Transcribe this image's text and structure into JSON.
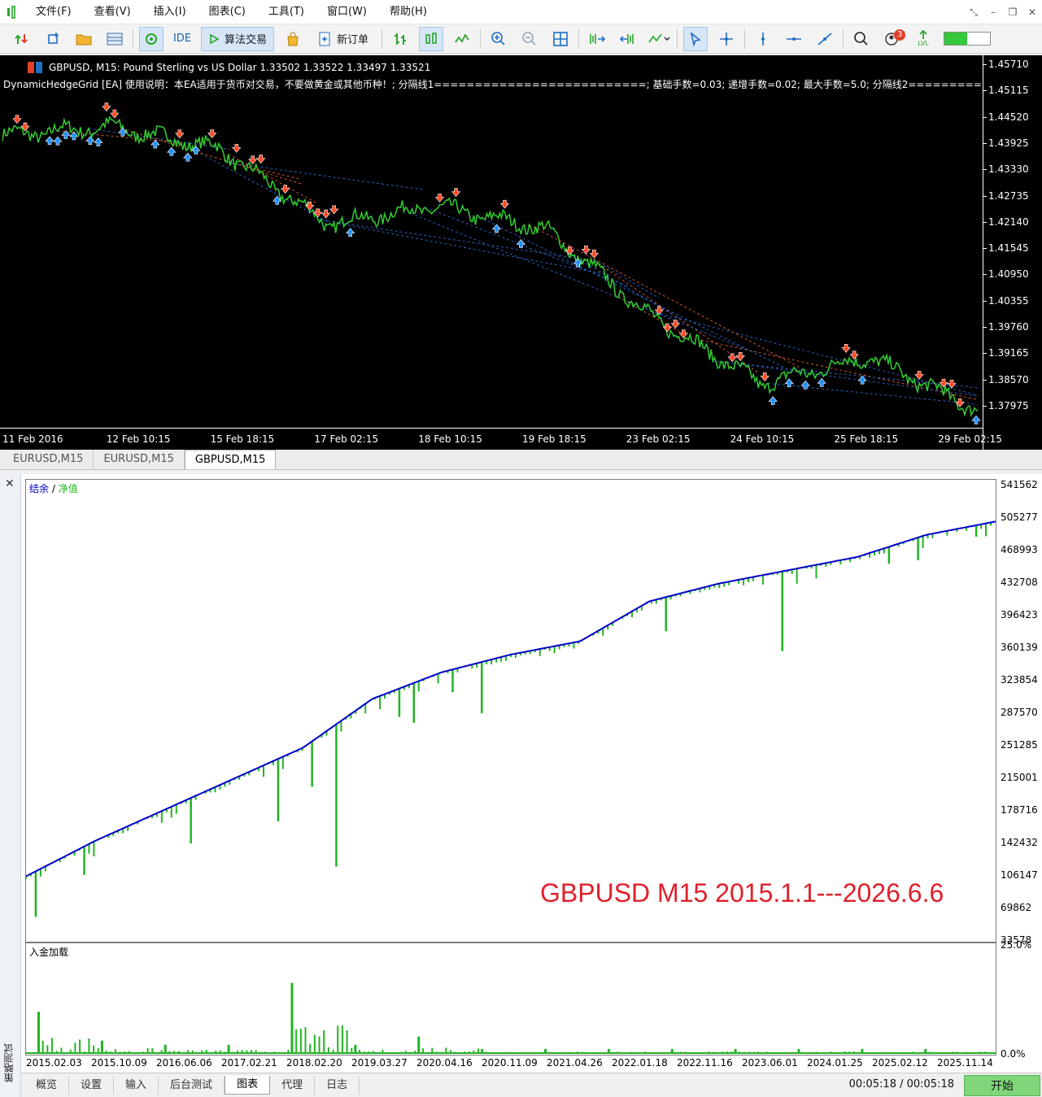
{
  "menu": {
    "items": [
      "文件(F)",
      "查看(V)",
      "插入(I)",
      "图表(C)",
      "工具(T)",
      "窗口(W)",
      "帮助(H)"
    ]
  },
  "toolbar": {
    "ide_label": "IDE",
    "algo_label": "算法交易",
    "new_order_label": "新订单",
    "notification_count": "3",
    "lvl_label": "LVL",
    "lvl_level": 0.5,
    "icons": [
      "new-chart-icon",
      "add-icon",
      "folder-icon",
      "profiles-icon",
      "algo-settings-icon",
      "play-icon",
      "shopping-bag-icon",
      "new-order-icon",
      "bar-chart-icon",
      "candlestick-icon",
      "line-chart-icon",
      "zoom-in-icon",
      "zoom-out-icon",
      "grid-icon",
      "shift-chart-icon",
      "autoscroll-icon",
      "indicators-icon",
      "cursor-icon",
      "crosshair-icon",
      "vertical-line-icon",
      "horizontal-line-icon",
      "trendline-icon",
      "search-icon",
      "notifications-icon",
      "lvl-icon"
    ]
  },
  "price_chart": {
    "title": "GBPUSD, M15: Pound Sterling vs US Dollar  1.33502 1.33522 1.33497 1.33521",
    "ea_info": "DynamicHedgeGrid [EA] 使用说明：本EA适用于货币对交易，不要做黄金或其他币种！; 分隔线1==========================; 基础手数=0.03; 递增手数=0.02; 最大手数=5.0; 分隔线2============",
    "y_ticks": [
      "1.45710",
      "1.45115",
      "1.44520",
      "1.43925",
      "1.43330",
      "1.42735",
      "1.42140",
      "1.41545",
      "1.40950",
      "1.40355",
      "1.39760",
      "1.39165",
      "1.38570",
      "1.37975"
    ],
    "x_ticks": [
      "11 Feb 2016",
      "12 Feb 10:15",
      "15 Feb 18:15",
      "17 Feb 02:15",
      "18 Feb 10:15",
      "19 Feb 18:15",
      "23 Feb 02:15",
      "24 Feb 10:15",
      "25 Feb 18:15",
      "29 Feb 02:15"
    ],
    "colors": {
      "background": "#000000",
      "price_line": "#32cd32",
      "buy_arrow": "#1e90ff",
      "sell_arrow": "#ff4a26"
    }
  },
  "chart_tabs": [
    "EURUSD,M15",
    "EURUSD,M15",
    "GBPUSD,M15"
  ],
  "tester": {
    "side_label": "策略测试",
    "legend_balance": "结余",
    "legend_sep": " / ",
    "legend_equity": "净值",
    "overlay_label": "GBPUSD M15 2015.1.1---2026.6.6",
    "equity_y_ticks": [
      "541562",
      "505277",
      "468993",
      "432708",
      "396423",
      "360139",
      "323854",
      "287570",
      "251285",
      "215001",
      "178716",
      "142432",
      "106147",
      "69862",
      "33578"
    ],
    "load_title": "入金加载",
    "load_y_ticks": [
      "25.0%",
      "0.0%"
    ],
    "date_ticks": [
      "2015.02.03",
      "2015.10.09",
      "2016.06.06",
      "2017.02.21",
      "2018.02.20",
      "2019.03.27",
      "2020.04.16",
      "2020.11.09",
      "2021.04.26",
      "2022.01.18",
      "2022.11.16",
      "2023.06.01",
      "2024.01.25",
      "2025.02.12",
      "2025.11.14"
    ],
    "bottom_tabs": [
      "概览",
      "设置",
      "输入",
      "后台测试",
      "图表",
      "代理",
      "日志"
    ],
    "timer": "00:05:18 / 00:05:18",
    "start_label": "开始",
    "colors": {
      "balance": "#0000c8",
      "equity": "#22b422",
      "overlay": "#e0202c"
    }
  },
  "chart_data": [
    {
      "type": "line",
      "title": "GBPUSD, M15",
      "xlabel": "",
      "ylabel": "",
      "ylim": [
        1.3767,
        1.4601
      ],
      "x": [
        "11 Feb 2016",
        "12 Feb 10:15",
        "15 Feb 18:15",
        "17 Feb 02:15",
        "18 Feb 10:15",
        "19 Feb 18:15",
        "23 Feb 02:15",
        "24 Feb 10:15",
        "25 Feb 18:15",
        "29 Feb 02:15"
      ],
      "series": [
        {
          "name": "",
          "values": [
            1.449,
            1.451,
            1.446,
            1.429,
            1.433,
            1.428,
            1.408,
            1.393,
            1.399,
            1.387
          ]
        }
      ]
    },
    {
      "type": "line",
      "title": "",
      "xlabel": "",
      "ylabel": "",
      "ylim": [
        33578,
        541562
      ],
      "x": [
        "2015.02.03",
        "2015.10.09",
        "2016.06.06",
        "2017.02.21",
        "2018.02.20",
        "2019.03.27",
        "2020.04.16",
        "2020.11.09",
        "2021.04.26",
        "2022.01.18",
        "2022.11.16",
        "2023.06.01",
        "2024.01.25",
        "2025.02.12",
        "2025.11.14"
      ],
      "series": [
        {
          "name": "结余",
          "values": [
            100000,
            140000,
            175000,
            210000,
            245000,
            300000,
            330000,
            350000,
            365000,
            410000,
            430000,
            445000,
            460000,
            485000,
            500000
          ]
        },
        {
          "name": "净值",
          "values": [
            100000,
            140000,
            175000,
            210000,
            245000,
            300000,
            330000,
            350000,
            365000,
            410000,
            430000,
            445000,
            460000,
            485000,
            500000
          ]
        }
      ]
    },
    {
      "type": "bar",
      "title": "入金加载",
      "xlabel": "",
      "ylabel": "",
      "ylim": [
        0,
        25
      ],
      "x": [
        "2015.02.03",
        "2015.10.09",
        "2016.06.06",
        "2017.02.21",
        "2018.02.20",
        "2019.03.27",
        "2020.04.16",
        "2020.11.09",
        "2021.04.26",
        "2022.01.18",
        "2022.11.16",
        "2023.06.01",
        "2024.01.25",
        "2025.02.12",
        "2025.11.14"
      ],
      "values": [
        10,
        3,
        2,
        2,
        17,
        2,
        4,
        1,
        1,
        1,
        1,
        1,
        1,
        1,
        1
      ]
    }
  ]
}
